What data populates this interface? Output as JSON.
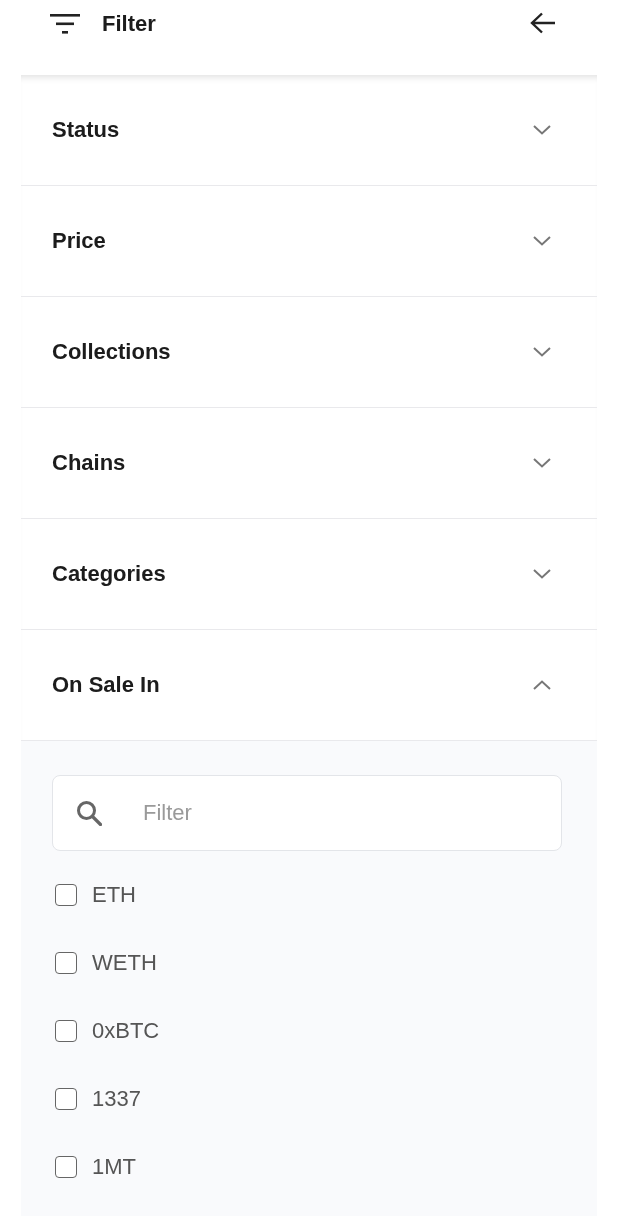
{
  "header": {
    "title": "Filter"
  },
  "sections": [
    {
      "title": "Status",
      "expanded": false
    },
    {
      "title": "Price",
      "expanded": false
    },
    {
      "title": "Collections",
      "expanded": false
    },
    {
      "title": "Chains",
      "expanded": false
    },
    {
      "title": "Categories",
      "expanded": false
    },
    {
      "title": "On Sale In",
      "expanded": true,
      "search": {
        "placeholder": "Filter"
      },
      "options": [
        {
          "label": "ETH",
          "checked": false
        },
        {
          "label": "WETH",
          "checked": false
        },
        {
          "label": "0xBTC",
          "checked": false
        },
        {
          "label": "1337",
          "checked": false
        },
        {
          "label": "1MT",
          "checked": false
        }
      ]
    }
  ]
}
